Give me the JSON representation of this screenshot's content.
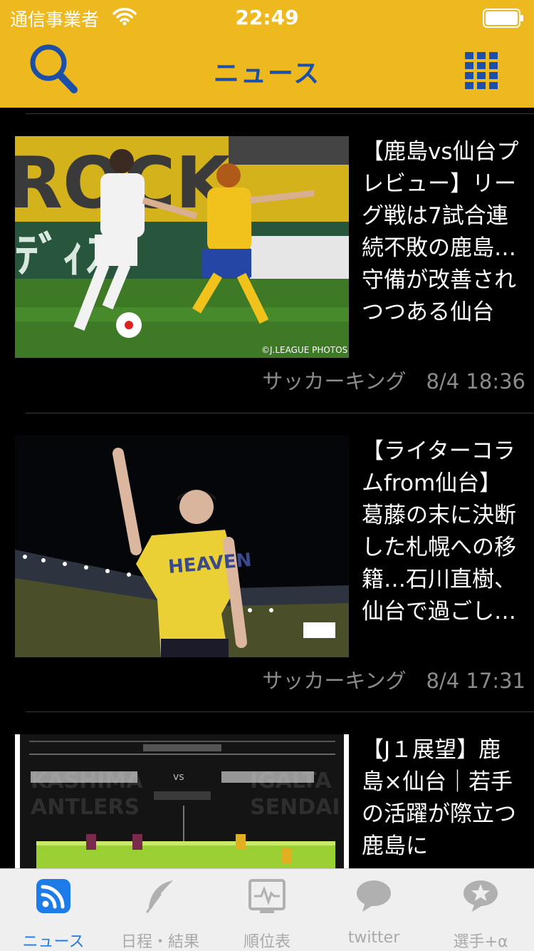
{
  "status_bar": {
    "carrier": "通信事業者",
    "time": "22:49"
  },
  "nav": {
    "title": "ニュース"
  },
  "articles": [
    {
      "headline": "【鹿島vs仙台プレビュー】リーグ戦は7試合連続不敗の鹿島…守備が改善されつつある仙台",
      "source": "サッカーキング",
      "date": "8/4 18:36",
      "photo_credit": "©J.LEAGUE PHOTOS"
    },
    {
      "headline": "【ライターコラムfrom仙台】葛藤の末に決断した札幌への移籍…石川直樹、仙台で過ごし…",
      "source": "サッカーキング",
      "date": "8/4 17:31"
    },
    {
      "headline": "【J１展望】鹿島×仙台｜若手の活躍が際立つ鹿島に",
      "source": "",
      "date": ""
    }
  ],
  "tabs": [
    {
      "label": "ニュース",
      "icon": "rss-icon",
      "active": true
    },
    {
      "label": "日程・結果",
      "icon": "feather-icon",
      "active": false
    },
    {
      "label": "順位表",
      "icon": "chart-icon",
      "active": false
    },
    {
      "label": "twitter",
      "icon": "speech-bubble-icon",
      "active": false
    },
    {
      "label": "選手+α",
      "icon": "star-bubble-icon",
      "active": false
    }
  ],
  "colors": {
    "header": "#EEB81F",
    "accent_blue": "#1B4FA8",
    "tab_active": "#1E7CE8"
  }
}
